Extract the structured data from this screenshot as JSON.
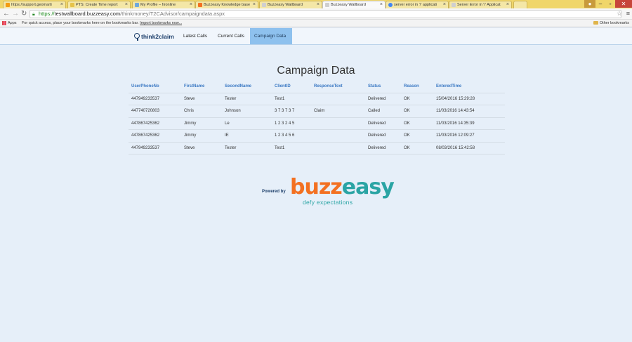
{
  "browser": {
    "tabs": [
      {
        "label": "https://support.geomarti",
        "color": "#f39c12"
      },
      {
        "label": "PTS: Create Time report",
        "color": "#e6c34a"
      },
      {
        "label": "My Profile – hronline",
        "color": "#6fa8dc"
      },
      {
        "label": "Buzzeasy Knowledge base",
        "color": "#f37021"
      },
      {
        "label": "Buzzeasy Wallboard",
        "color": "#cfcfcf"
      },
      {
        "label": "Buzzeasy Wallboard",
        "color": "#cfcfcf"
      },
      {
        "label": "server error in '/' applicati",
        "color": "#4285f4"
      },
      {
        "label": "Server Error in '/' Applicat",
        "color": "#cfcfcf"
      }
    ],
    "url_secure": "https://",
    "url_host": "testwallboard.buzzeasy.com",
    "url_path": "/thinkmoney/T2CAdvisor/campaigndata.aspx",
    "bookmarks": {
      "apps_label": "Apps",
      "hint": "For quick access, place your bookmarks here on the bookmarks bar.",
      "import_link": "Import bookmarks now...",
      "other": "Other bookmarks"
    }
  },
  "nav": {
    "logo": "think2claim",
    "links": [
      "Latest Calls",
      "Current Calls",
      "Campaign Data"
    ],
    "active_index": 2,
    "accent": "#8ec1ee"
  },
  "page": {
    "title": "Campaign Data"
  },
  "table": {
    "headers": [
      "UserPhoneNo",
      "FirstName",
      "SecondName",
      "ClientID",
      "ResponseText",
      "Status",
      "Reason",
      "EnteredTime"
    ],
    "rows": [
      [
        "447949233537",
        "Steve",
        "Tester",
        "Test1",
        "",
        "Delivered",
        "OK",
        "15/04/2016 15:29:28"
      ],
      [
        "447740720803",
        "Chris",
        "Johnson",
        "3 7 3 7 3 7",
        "Claim",
        "Called",
        "OK",
        "11/03/2016 14:43:54"
      ],
      [
        "447867425362",
        "Jimmy",
        "Le",
        "1 2 3 2 4 5",
        "",
        "Delivered",
        "OK",
        "11/03/2016 14:35:39"
      ],
      [
        "447867425362",
        "Jimmy",
        "IE",
        "1 2 3 4 5 6",
        "",
        "Delivered",
        "OK",
        "11/03/2016 12:09:27"
      ],
      [
        "447949233537",
        "Steve",
        "Tester",
        "Test1",
        "",
        "Delivered",
        "OK",
        "08/03/2016 15:42:58"
      ]
    ]
  },
  "footer": {
    "powered_by": "Powered by",
    "brand_part1": "buzz",
    "brand_part2": "easy",
    "tagline": "defy expectations",
    "brand_orange": "#f37021",
    "brand_teal": "#2aa4a4"
  }
}
